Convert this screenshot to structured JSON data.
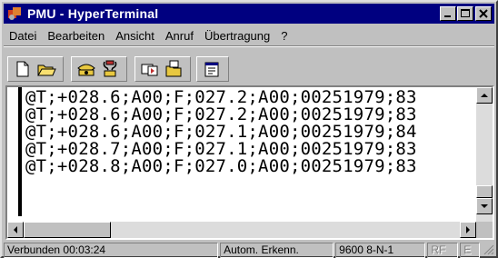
{
  "window": {
    "title": "PMU - HyperTerminal",
    "buttons": [
      {
        "name": "minimize-button",
        "symbol": "_"
      },
      {
        "name": "maximize-button",
        "symbol": "□"
      },
      {
        "name": "close-button",
        "symbol": "×"
      }
    ]
  },
  "menu": {
    "items": [
      {
        "label": "Datei"
      },
      {
        "label": "Bearbeiten"
      },
      {
        "label": "Ansicht"
      },
      {
        "label": "Anruf"
      },
      {
        "label": "Übertragung"
      },
      {
        "label": "?"
      }
    ]
  },
  "toolbar": {
    "icons": [
      "new-icon",
      "open-icon",
      "connect-icon",
      "disconnect-icon",
      "send-icon",
      "receive-icon",
      "properties-icon"
    ]
  },
  "terminal": {
    "lines": [
      "@T;+028.6;A00;F;027.2;A00;00251979;83",
      "@T;+028.6;A00;F;027.2;A00;00251979;83",
      "@T;+028.6;A00;F;027.1;A00;00251979;84",
      "@T;+028.7;A00;F;027.1;A00;00251979;83",
      "@T;+028.8;A00;F;027.0;A00;00251979;83"
    ]
  },
  "status": {
    "connected": "Verbunden 00:03:24",
    "detect": "Autom. Erkenn.",
    "settings": "9600 8-N-1",
    "rf": "RF",
    "echo": "E"
  },
  "colors": {
    "titlebar": "#000080",
    "chrome": "#c0c0c0"
  }
}
